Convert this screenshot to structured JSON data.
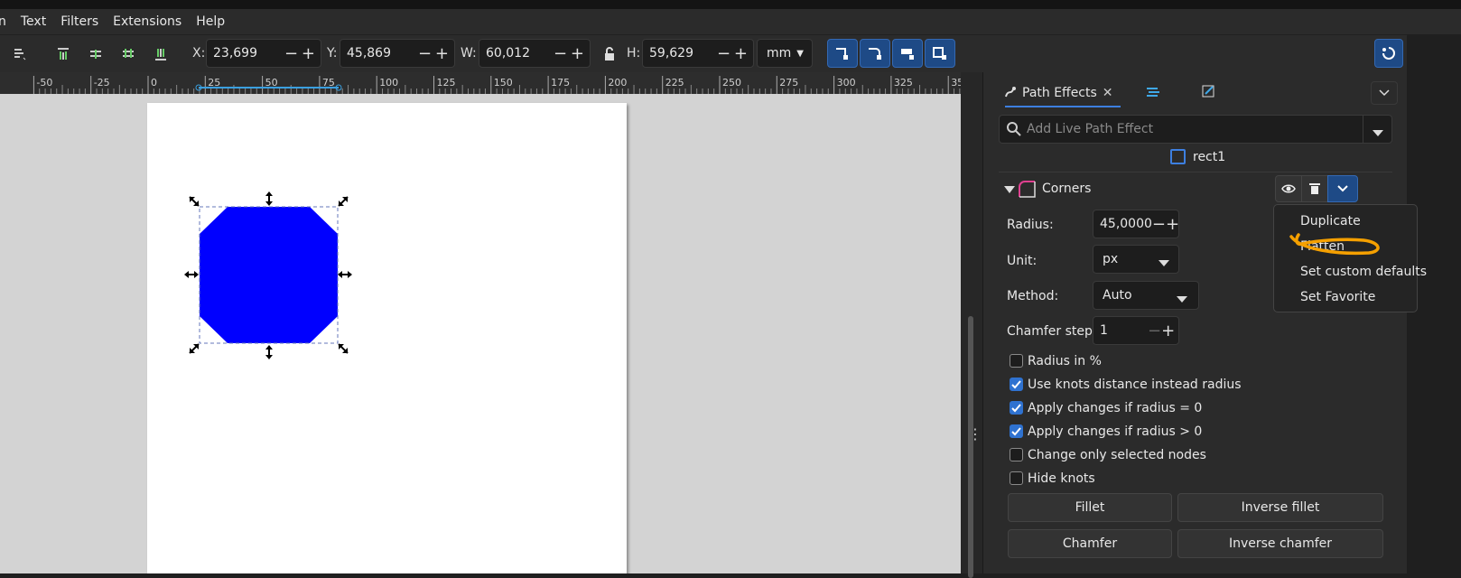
{
  "menubar": {
    "items": [
      "n",
      "Text",
      "Filters",
      "Extensions",
      "Help"
    ]
  },
  "toolbar": {
    "x": {
      "label": "X:",
      "value": "23,699"
    },
    "y": {
      "label": "Y:",
      "value": "45,869"
    },
    "w": {
      "label": "W:",
      "value": "60,012"
    },
    "h": {
      "label": "H:",
      "value": "59,629"
    },
    "unit": "mm"
  },
  "ruler": {
    "ticks": [
      "-50",
      "-25",
      "0",
      "25",
      "50",
      "75",
      "100",
      "125",
      "150",
      "175",
      "200",
      "225",
      "250",
      "275",
      "300",
      "325",
      "35"
    ]
  },
  "canvas": {
    "shape_color": "#0000ff"
  },
  "panel": {
    "tab_title": "Path Effects",
    "search_placeholder": "Add Live Path Effect",
    "object_name": "rect1",
    "effect_name": "Corners",
    "params": {
      "radius_label": "Radius:",
      "radius_value": "45,0000",
      "unit_label": "Unit:",
      "unit_value": "px",
      "method_label": "Method:",
      "method_value": "Auto",
      "steps_label": "Chamfer steps:",
      "steps_value": "1"
    },
    "checks": [
      {
        "label": "Radius in %",
        "checked": false
      },
      {
        "label": "Use knots distance instead radius",
        "checked": true
      },
      {
        "label": "Apply changes if radius = 0",
        "checked": true
      },
      {
        "label": "Apply changes if radius > 0",
        "checked": true
      },
      {
        "label": "Change only selected nodes",
        "checked": false
      },
      {
        "label": "Hide knots",
        "checked": false
      }
    ],
    "buttons": {
      "fillet": "Fillet",
      "inverse_fillet": "Inverse fillet",
      "chamfer": "Chamfer",
      "inverse_chamfer": "Inverse chamfer"
    }
  },
  "dropdown_menu": {
    "items": [
      "Duplicate",
      "Flatten",
      "Set custom defaults",
      "Set Favorite"
    ]
  },
  "colors": {
    "accent": "#2f72d0",
    "highlight_stroke": "#f5a000"
  }
}
